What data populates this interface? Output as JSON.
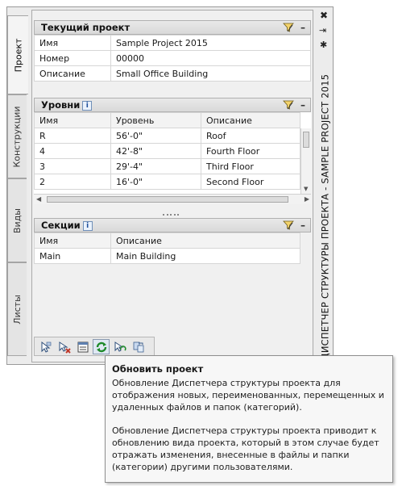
{
  "palette": {
    "title": "ДИСПЕТЧЕР СТРУКТУРЫ ПРОЕКТА - SAMPLE PROJECT 2015",
    "tabs": [
      "Проект",
      "Конструкции",
      "Виды",
      "Листы"
    ],
    "active_tab": "Проект"
  },
  "current_project": {
    "header": "Текущий проект",
    "rows": [
      {
        "label": "Имя",
        "value": "Sample Project 2015"
      },
      {
        "label": "Номер",
        "value": "00000"
      },
      {
        "label": "Описание",
        "value": "Small Office Building"
      }
    ]
  },
  "levels": {
    "header": "Уровни",
    "columns": [
      "Имя",
      "Уровень",
      "Описание"
    ],
    "rows": [
      {
        "name": "R",
        "level": "56'-0\"",
        "desc": "Roof"
      },
      {
        "name": "4",
        "level": "42'-8\"",
        "desc": "Fourth Floor"
      },
      {
        "name": "3",
        "level": "29'-4\"",
        "desc": "Third Floor"
      },
      {
        "name": "2",
        "level": "16'-0\"",
        "desc": "Second Floor"
      }
    ]
  },
  "sections": {
    "header": "Секции",
    "columns": [
      "Имя",
      "Описание"
    ],
    "rows": [
      {
        "name": "Main",
        "desc": "Main Building"
      }
    ]
  },
  "toolbar": {
    "buttons": [
      "select-icon",
      "delete-icon",
      "properties-icon",
      "refresh-icon",
      "repath-icon",
      "sync-icon"
    ],
    "hot_button": "refresh-icon"
  },
  "tooltip": {
    "title": "Обновить проект",
    "paragraph1": "Обновление Диспетчера структуры проекта для отображения новых, переименованных, перемещенных и удаленных файлов и папок (категорий).",
    "paragraph2": "Обновление Диспетчера структуры проекта приводит к обновлению вида проекта, который в этом случае будет отражать изменения, внесенные в файлы и папки (категории) другими пользователями."
  },
  "colors": {
    "refresh_green": "#1e8a2a",
    "info_blue": "#1f4f9a",
    "delete_red": "#c0392b"
  }
}
